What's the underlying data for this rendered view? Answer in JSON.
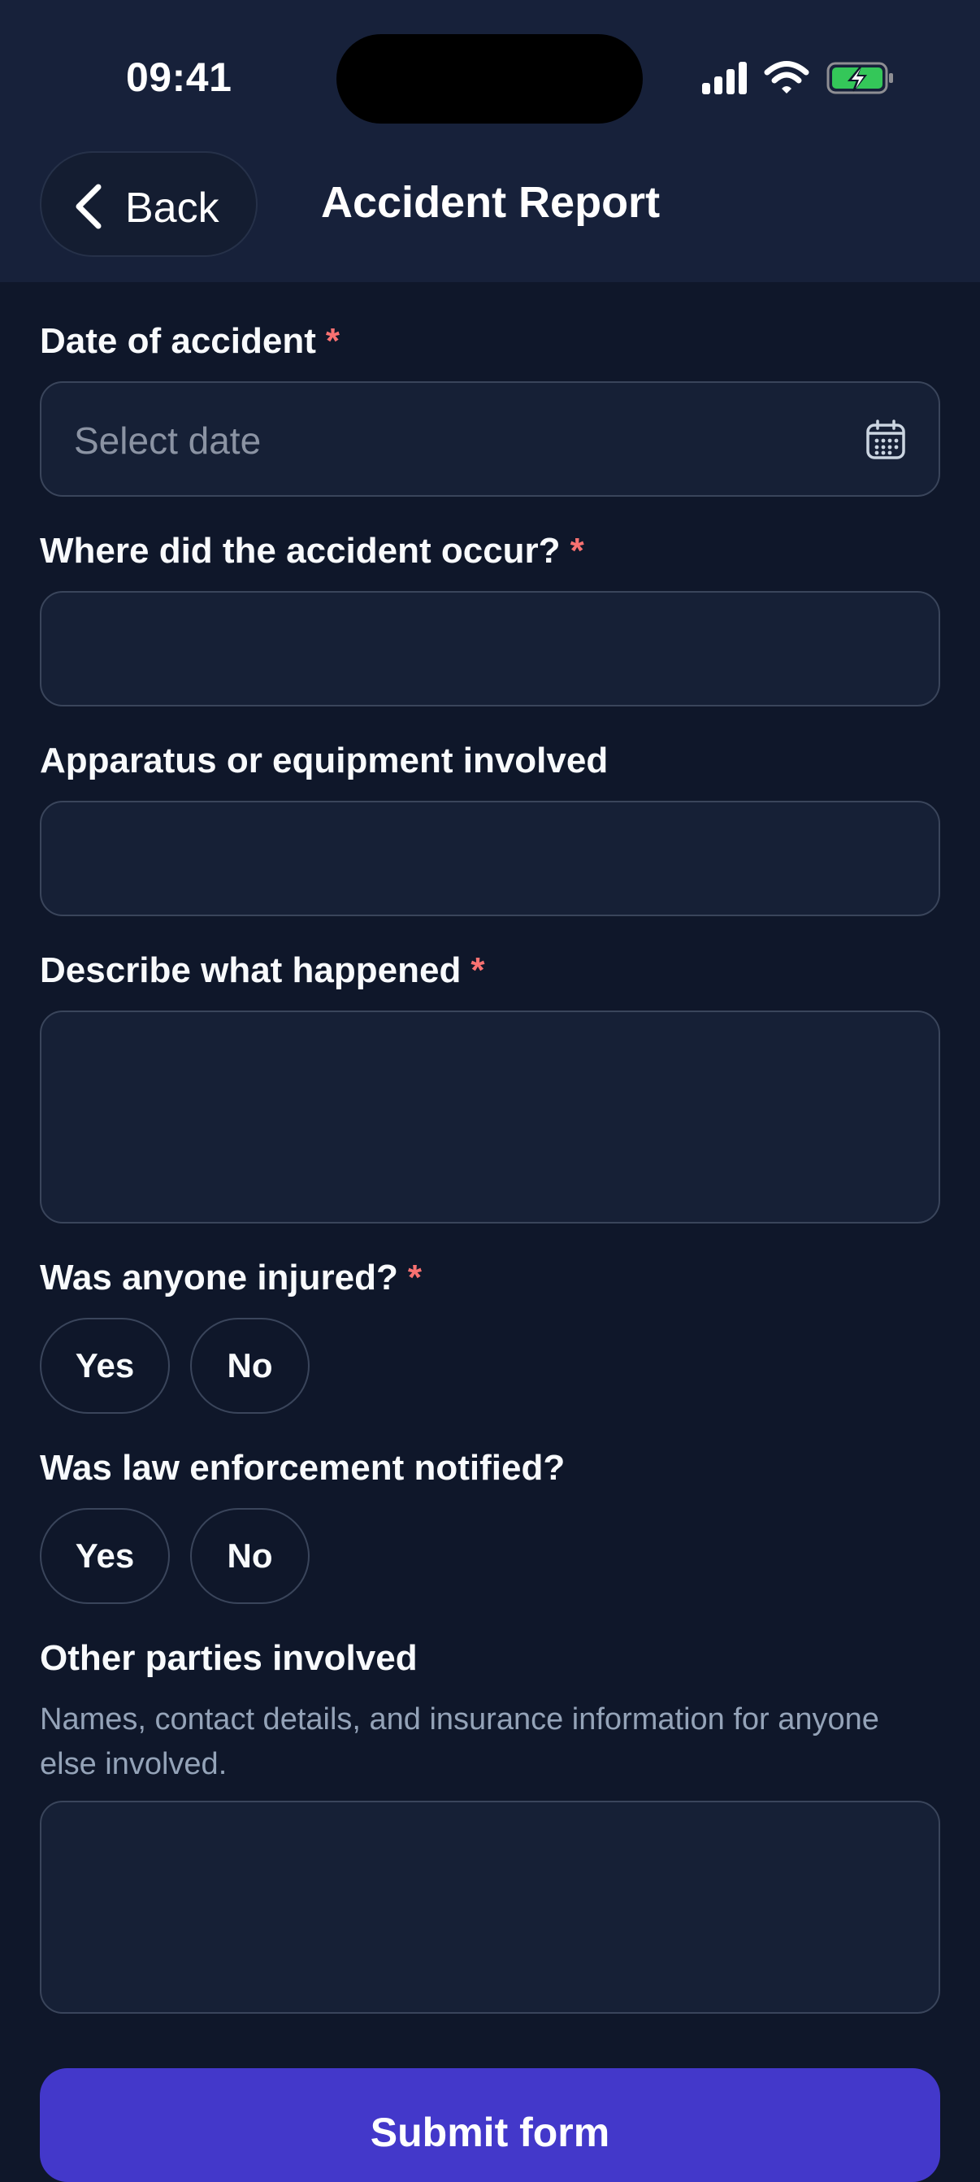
{
  "status_bar": {
    "time": "09:41",
    "icons": [
      "cellular-signal-icon",
      "wifi-icon",
      "battery-charging-icon"
    ],
    "battery_color": "#34c759"
  },
  "header": {
    "back_label": "Back",
    "title": "Accident Report"
  },
  "form": {
    "date": {
      "label": "Date of accident",
      "required_mark": "*",
      "placeholder": "Select date",
      "icon": "calendar-icon"
    },
    "location": {
      "label": "Where did the accident occur?",
      "required_mark": "*",
      "value": ""
    },
    "equipment": {
      "label": "Apparatus or equipment involved",
      "value": ""
    },
    "description": {
      "label": "Describe what happened",
      "required_mark": "*",
      "value": ""
    },
    "injured": {
      "label": "Was anyone injured?",
      "required_mark": "*",
      "options": [
        "Yes",
        "No"
      ]
    },
    "law_enforcement": {
      "label": "Was law enforcement notified?",
      "options": [
        "Yes",
        "No"
      ]
    },
    "other_parties": {
      "label": "Other parties involved",
      "helper": "Names, contact details, and insurance information for anyone else involved.",
      "value": ""
    },
    "submit_label": "Submit form"
  },
  "colors": {
    "background": "#0f172a",
    "header_background": "#17213a",
    "required": "#f87171",
    "accent": "#4338ca"
  }
}
